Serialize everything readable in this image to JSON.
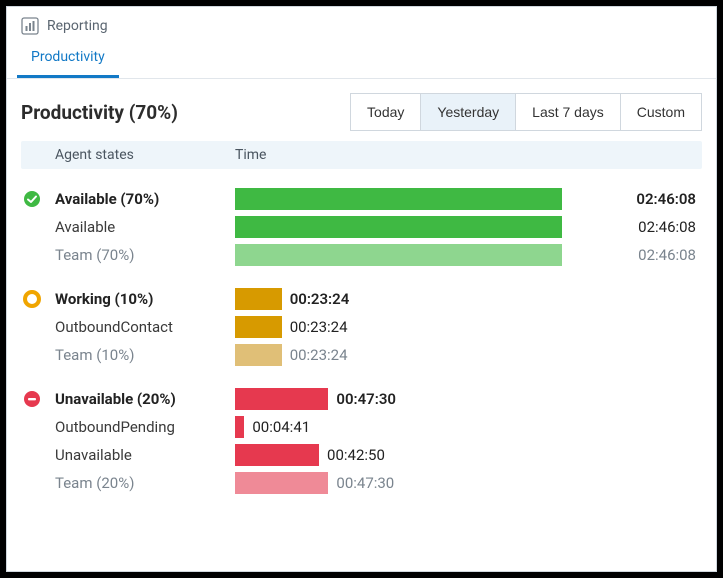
{
  "header": {
    "title": "Reporting"
  },
  "tabs": [
    {
      "label": "Productivity",
      "active": true
    }
  ],
  "page": {
    "title": "Productivity (70%)"
  },
  "range": {
    "options": [
      {
        "label": "Today",
        "active": false
      },
      {
        "label": "Yesterday",
        "active": true
      },
      {
        "label": "Last 7 days",
        "active": false
      },
      {
        "label": "Custom",
        "active": false
      }
    ]
  },
  "columns": {
    "label": "Agent states",
    "time": "Time"
  },
  "colors": {
    "available": "#3fb943",
    "available_team": "#8ed68f",
    "working": "#d79a00",
    "working_team": "#e0bf77",
    "unavailable": "#e6394f",
    "unavailable_team": "#ef8a97"
  },
  "groups": [
    {
      "id": "available",
      "icon": "check",
      "icon_color": "#3fb943",
      "rows": [
        {
          "kind": "head",
          "label": "Available (70%)",
          "time": "02:46:08",
          "pct": 70,
          "colorKey": "available",
          "timeRight": true
        },
        {
          "kind": "sub",
          "label": "Available",
          "time": "02:46:08",
          "pct": 70,
          "colorKey": "available",
          "timeRight": true
        },
        {
          "kind": "team",
          "label": "Team (70%)",
          "time": "02:46:08",
          "pct": 70,
          "colorKey": "available_team",
          "timeRight": true
        }
      ]
    },
    {
      "id": "working",
      "icon": "ring",
      "icon_color": "#f0a500",
      "rows": [
        {
          "kind": "head",
          "label": "Working (10%)",
          "time": "00:23:24",
          "pct": 10,
          "colorKey": "working",
          "timeRight": false
        },
        {
          "kind": "sub",
          "label": "OutboundContact",
          "time": "00:23:24",
          "pct": 10,
          "colorKey": "working",
          "timeRight": false
        },
        {
          "kind": "team",
          "label": "Team (10%)",
          "time": "00:23:24",
          "pct": 10,
          "colorKey": "working_team",
          "timeRight": false
        }
      ]
    },
    {
      "id": "unavailable",
      "icon": "stop",
      "icon_color": "#e6394f",
      "rows": [
        {
          "kind": "head",
          "label": "Unavailable (20%)",
          "time": "00:47:30",
          "pct": 20,
          "colorKey": "unavailable",
          "timeRight": false
        },
        {
          "kind": "sub",
          "label": "OutboundPending",
          "time": "00:04:41",
          "pct": 2,
          "colorKey": "unavailable",
          "timeRight": false
        },
        {
          "kind": "sub",
          "label": "Unavailable",
          "time": "00:42:50",
          "pct": 18,
          "colorKey": "unavailable",
          "timeRight": false
        },
        {
          "kind": "team",
          "label": "Team (20%)",
          "time": "00:47:30",
          "pct": 20,
          "colorKey": "unavailable_team",
          "timeRight": false
        }
      ]
    }
  ],
  "chart_data": {
    "type": "bar",
    "title": "Productivity (70%)",
    "xlabel": "Time",
    "ylabel": "Agent states",
    "series": [
      {
        "group": "Available",
        "name": "Available (70%)",
        "value": "02:46:08",
        "seconds": 9968,
        "pct": 70
      },
      {
        "group": "Available",
        "name": "Available",
        "value": "02:46:08",
        "seconds": 9968,
        "pct": 70
      },
      {
        "group": "Available",
        "name": "Team (70%)",
        "value": "02:46:08",
        "seconds": 9968,
        "pct": 70
      },
      {
        "group": "Working",
        "name": "Working (10%)",
        "value": "00:23:24",
        "seconds": 1404,
        "pct": 10
      },
      {
        "group": "Working",
        "name": "OutboundContact",
        "value": "00:23:24",
        "seconds": 1404,
        "pct": 10
      },
      {
        "group": "Working",
        "name": "Team (10%)",
        "value": "00:23:24",
        "seconds": 1404,
        "pct": 10
      },
      {
        "group": "Unavailable",
        "name": "Unavailable (20%)",
        "value": "00:47:30",
        "seconds": 2850,
        "pct": 20
      },
      {
        "group": "Unavailable",
        "name": "OutboundPending",
        "value": "00:04:41",
        "seconds": 281,
        "pct": 2
      },
      {
        "group": "Unavailable",
        "name": "Unavailable",
        "value": "00:42:50",
        "seconds": 2570,
        "pct": 18
      },
      {
        "group": "Unavailable",
        "name": "Team (20%)",
        "value": "00:47:30",
        "seconds": 2850,
        "pct": 20
      }
    ]
  }
}
